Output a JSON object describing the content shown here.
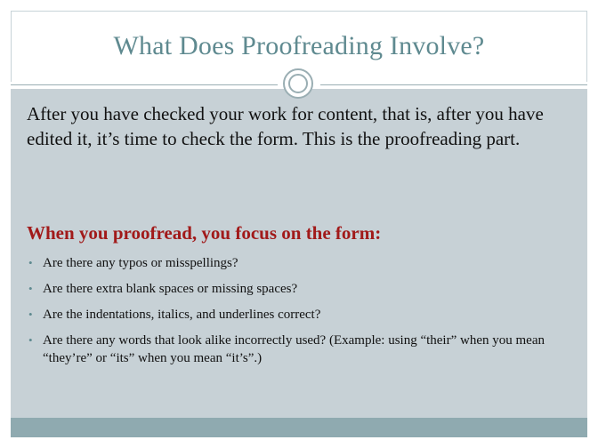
{
  "slide": {
    "title": "What Does Proofreading Involve?",
    "intro": "After you have checked your work for content, that is, after you have edited it, it’s time to check the form. This is the proofreading part.",
    "subheading": "When you proofread, you focus on the form:",
    "bullets": [
      "Are there any typos or misspellings?",
      "Are there extra blank spaces or missing spaces?",
      "Are the indentations, italics, and underlines correct?",
      "Are there any words that look alike incorrectly used? (Example:  using “their” when you mean “they’re” or “its” when you mean “it’s”.)"
    ],
    "bullet_glyph": "•"
  },
  "colors": {
    "title": "#5f8a90",
    "panel": "#c7d1d6",
    "footer": "#8faab0",
    "subheading": "#a11a1a"
  }
}
